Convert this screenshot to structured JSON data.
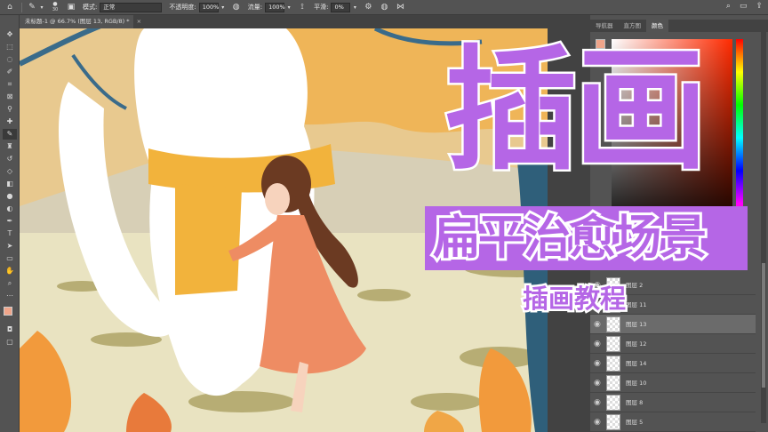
{
  "options_bar": {
    "brush_size": "30",
    "mode_label": "模式:",
    "mode_value": "正常",
    "opacity_label": "不透明度:",
    "opacity_value": "100%",
    "flow_label": "流量:",
    "flow_value": "100%",
    "smoothing_label": "平滑:",
    "smoothing_value": "0%"
  },
  "document": {
    "tab_title": "未标题-1 @ 66.7% (图层 13, RGB/8) *",
    "close_glyph": "×"
  },
  "panels": {
    "tabs": [
      "导航器",
      "直方图",
      "颜色"
    ],
    "active_tab": "颜色",
    "foreground_color": "#f0a58a"
  },
  "layers": [
    {
      "name": "图层 2",
      "selected": false
    },
    {
      "name": "图层 11",
      "selected": false
    },
    {
      "name": "图层 13",
      "selected": true
    },
    {
      "name": "图层 12",
      "selected": false
    },
    {
      "name": "图层 14",
      "selected": false
    },
    {
      "name": "图层 10",
      "selected": false
    },
    {
      "name": "图层 8",
      "selected": false
    },
    {
      "name": "图层 5",
      "selected": false
    }
  ],
  "overlay": {
    "title": "插画",
    "subtitle": "扁平治愈场景",
    "tag": "插画教程"
  },
  "colors": {
    "accent_purple": "#b566e6",
    "foreground": "#f0a58a",
    "background": "#ffffff"
  },
  "icons": [
    "home-icon",
    "brush-icon",
    "airbrush-icon",
    "smoothing-gear-icon",
    "butterfly-symmetry-icon",
    "search-icon",
    "workspace-icon",
    "share-icon"
  ]
}
